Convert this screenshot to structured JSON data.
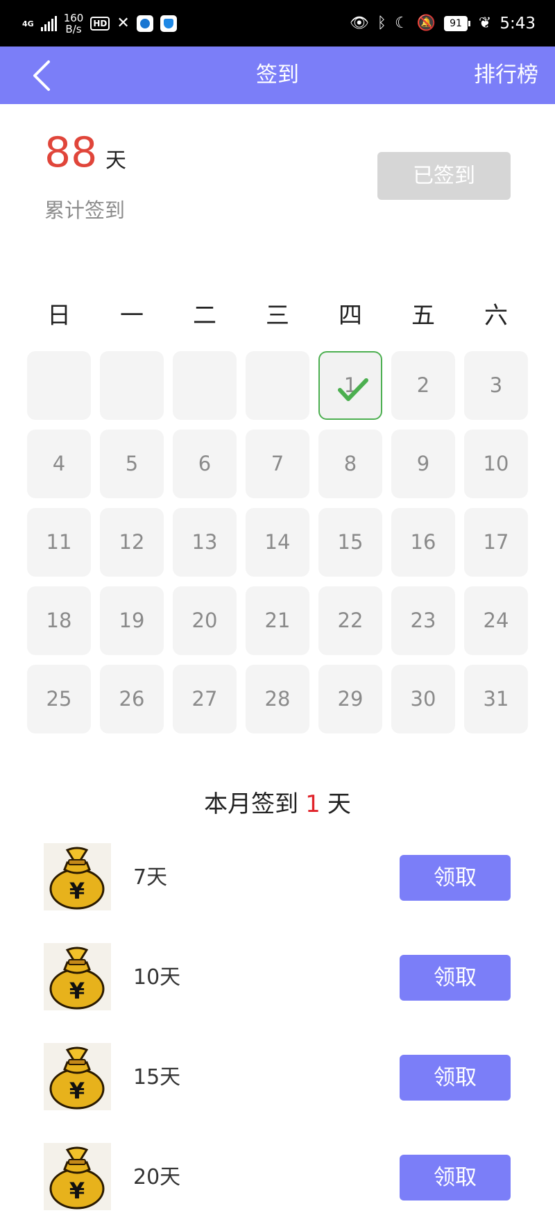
{
  "status_bar": {
    "network": "4G",
    "speed_value": "160",
    "speed_unit": "B/s",
    "hd_badge": "HD",
    "battery": "91",
    "time": "5:43"
  },
  "navbar": {
    "title": "签到",
    "action_label": "排行榜"
  },
  "summary": {
    "total_days": "88",
    "total_unit": "天",
    "total_label": "累计签到",
    "signed_button_label": "已签到"
  },
  "calendar": {
    "weekdays": [
      "日",
      "一",
      "二",
      "三",
      "四",
      "五",
      "六"
    ],
    "leading_blank_days": 4,
    "days": [
      "1",
      "2",
      "3",
      "4",
      "5",
      "6",
      "7",
      "8",
      "9",
      "10",
      "11",
      "12",
      "13",
      "14",
      "15",
      "16",
      "17",
      "18",
      "19",
      "20",
      "21",
      "22",
      "23",
      "24",
      "25",
      "26",
      "27",
      "28",
      "29",
      "30",
      "31"
    ],
    "checked_days": [
      "1"
    ],
    "colors": {
      "check": "#4caf50",
      "cell_bg": "#f4f4f4",
      "day_text": "#8a8a8a"
    }
  },
  "month_summary": {
    "prefix": "本月签到",
    "count": "1",
    "suffix": "天"
  },
  "rewards": [
    {
      "label": "7天",
      "button": "领取",
      "icon": "money-bag-icon"
    },
    {
      "label": "10天",
      "button": "领取",
      "icon": "money-bag-icon"
    },
    {
      "label": "15天",
      "button": "领取",
      "icon": "money-bag-icon"
    },
    {
      "label": "20天",
      "button": "领取",
      "icon": "money-bag-icon"
    }
  ],
  "theme": {
    "primary": "#7b7ef8",
    "accent_red": "#e0453a",
    "disabled_button": "#d6d6d6"
  }
}
